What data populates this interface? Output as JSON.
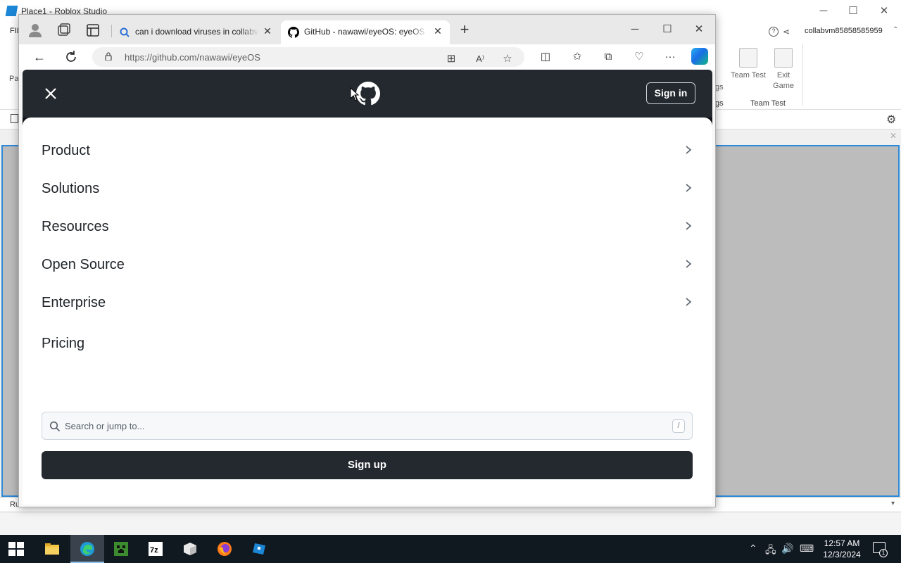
{
  "studio": {
    "window_title": "Place1 - Roblox Studio",
    "file_menu": "FIL",
    "user": "collabvm85858585959",
    "partial_label": "Pa",
    "tools": [
      {
        "label": "Team Test"
      },
      {
        "label": "Exit Game"
      }
    ],
    "group_label": "Team Test",
    "partial_gs": "gs",
    "command_placeholder": "Run a command"
  },
  "browser": {
    "tabs": [
      {
        "title": "can i download viruses in collabvm"
      },
      {
        "title": "GitHub - nawawi/eyeOS: eyeOS v"
      }
    ],
    "url": "https://github.com/nawawi/eyeOS"
  },
  "github": {
    "sign_in": "Sign in",
    "menu": [
      {
        "label": "Product",
        "has_submenu": true
      },
      {
        "label": "Solutions",
        "has_submenu": true
      },
      {
        "label": "Resources",
        "has_submenu": true
      },
      {
        "label": "Open Source",
        "has_submenu": true
      },
      {
        "label": "Enterprise",
        "has_submenu": true
      },
      {
        "label": "Pricing",
        "has_submenu": false
      }
    ],
    "search_placeholder": "Search or jump to...",
    "search_shortcut": "/",
    "sign_up": "Sign up"
  },
  "taskbar": {
    "time": "12:57 AM",
    "date": "12/3/2024",
    "notification_count": "1",
    "apps": [
      "file-explorer",
      "edge",
      "minecraft",
      "7zip",
      "box-app",
      "firefox",
      "roblox-studio"
    ]
  },
  "colors": {
    "github_header": "#24292f",
    "studio_selection": "#2e8ad8",
    "taskbar": "#101820"
  }
}
